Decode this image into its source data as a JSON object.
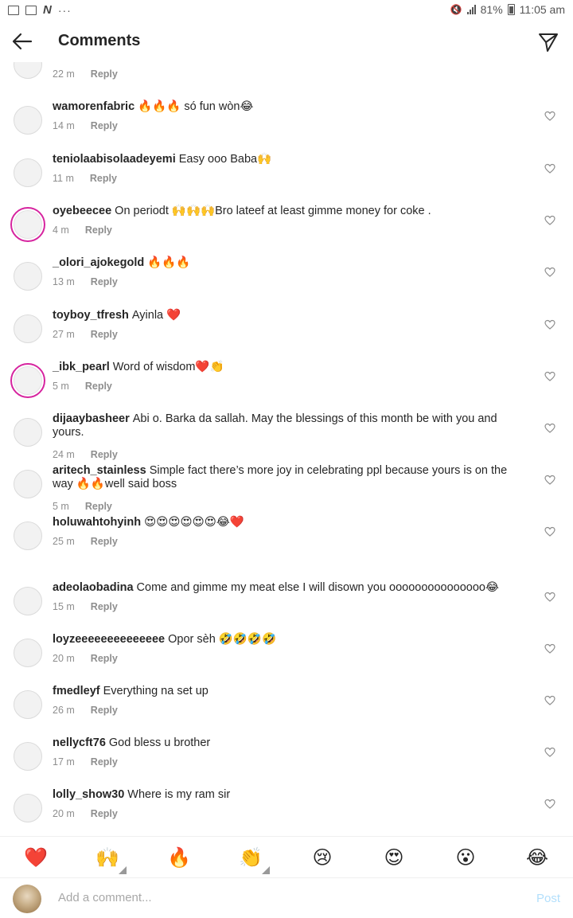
{
  "status_bar": {
    "battery": "81%",
    "time": "11:05 am"
  },
  "header": {
    "title": "Comments"
  },
  "first_partial": {
    "time": "22 m",
    "reply": "Reply"
  },
  "comments": [
    {
      "username": "wamorenfabric",
      "text": "🔥🔥🔥 só fun wòn😂",
      "time": "14 m",
      "reply": "Reply",
      "story": false
    },
    {
      "username": "teniolaabisolaadeyemi",
      "text": "Easy ooo Baba🙌",
      "time": "11 m",
      "reply": "Reply",
      "story": false
    },
    {
      "username": "oyebeecee",
      "text": "On periodt 🙌🙌🙌Bro lateef at least gimme money for coke .",
      "time": "4 m",
      "reply": "Reply",
      "story": true
    },
    {
      "username": "_olori_ajokegold",
      "text": "🔥🔥🔥",
      "time": "13 m",
      "reply": "Reply",
      "story": false
    },
    {
      "username": "toyboy_tfresh",
      "text": "Ayinla ❤️",
      "time": "27 m",
      "reply": "Reply",
      "story": false
    },
    {
      "username": "_ibk_pearl",
      "text": "Word of wisdom❤️👏",
      "time": "5 m",
      "reply": "Reply",
      "story": true
    },
    {
      "username": "dijaaybasheer",
      "text": "Abi o. Barka da sallah. May the blessings of this month be with you and yours.",
      "time": "24 m",
      "reply": "Reply",
      "story": false
    },
    {
      "username": "aritech_stainless",
      "text": "Simple fact there’s more joy in celebrating ppl because yours is on the way 🔥🔥well said boss",
      "time": "5 m",
      "reply": "Reply",
      "story": false
    },
    {
      "username": "holuwahtohyinh",
      "text": "😍😍😍😍😍😍😂❤️",
      "time": "25 m",
      "reply": "Reply",
      "story": false
    },
    {
      "username": "adeolaobadina",
      "text": "Come and gimme my meat else I will disown you ooooooooooooooo😂",
      "time": "15 m",
      "reply": "Reply",
      "story": false
    },
    {
      "username": "loyzeeeeeeeeeeeeee",
      "text": "Opor sèh 🤣🤣🤣🤣",
      "time": "20 m",
      "reply": "Reply",
      "story": false
    },
    {
      "username": "fmedleyf",
      "text": "Everything na set up",
      "time": "26 m",
      "reply": "Reply",
      "story": false
    },
    {
      "username": "nellycft76",
      "text": "God bless u brother",
      "time": "17 m",
      "reply": "Reply",
      "story": false
    },
    {
      "username": "lolly_show30",
      "text": "Where is my ram sir",
      "time": "20 m",
      "reply": "Reply",
      "story": false
    }
  ],
  "emoji_bar": [
    "❤️",
    "🙌",
    "🔥",
    "👏",
    "😢",
    "😍",
    "😮",
    "😂"
  ],
  "composer": {
    "placeholder": "Add a comment...",
    "post": "Post"
  },
  "colors": {
    "text": "#262626",
    "muted": "#8e8e8e",
    "post_disabled": "#b2dffc",
    "story_ring": "#d6249f"
  }
}
